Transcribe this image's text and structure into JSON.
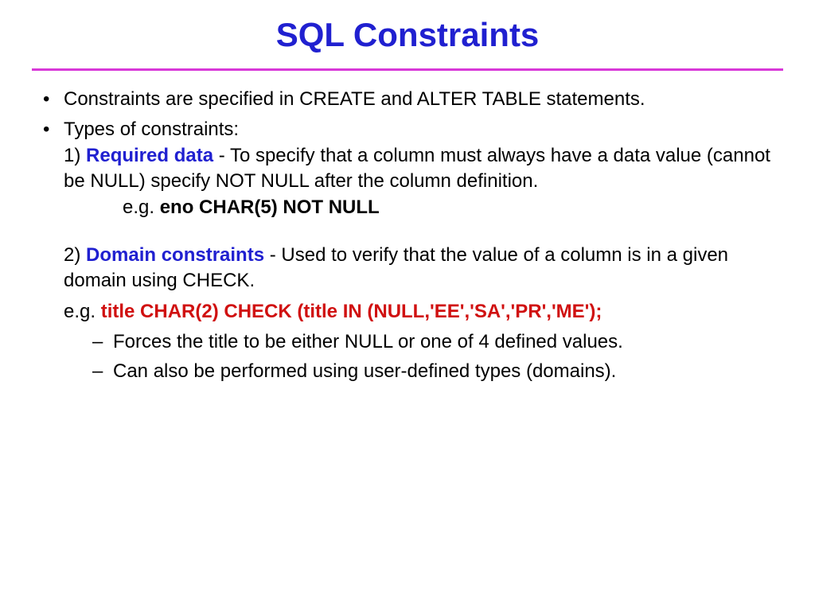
{
  "title": "SQL Constraints",
  "bullet1": "Constraints are specified in CREATE and ALTER TABLE statements.",
  "bullet2": "Types of constraints:",
  "item1_num": "1) ",
  "item1_label": "Required data",
  "item1_desc": " - To specify that a column must always have a data value (cannot be NULL) specify NOT NULL after the column definition.",
  "item1_eg_prefix": "e.g. ",
  "item1_eg_code": "eno CHAR(5) NOT NULL",
  "item2_num": "2) ",
  "item2_label": "Domain constraints",
  "item2_desc": " - Used to verify that the value of a column is in a given domain using CHECK.",
  "item2_eg_prefix": "e.g. ",
  "item2_eg_code": "title CHAR(2) CHECK (title IN (NULL,'EE','SA','PR','ME');",
  "dash1": "Forces the title to be either NULL or one of 4 defined values.",
  "dash2": "Can also be performed using user-defined types (domains)."
}
